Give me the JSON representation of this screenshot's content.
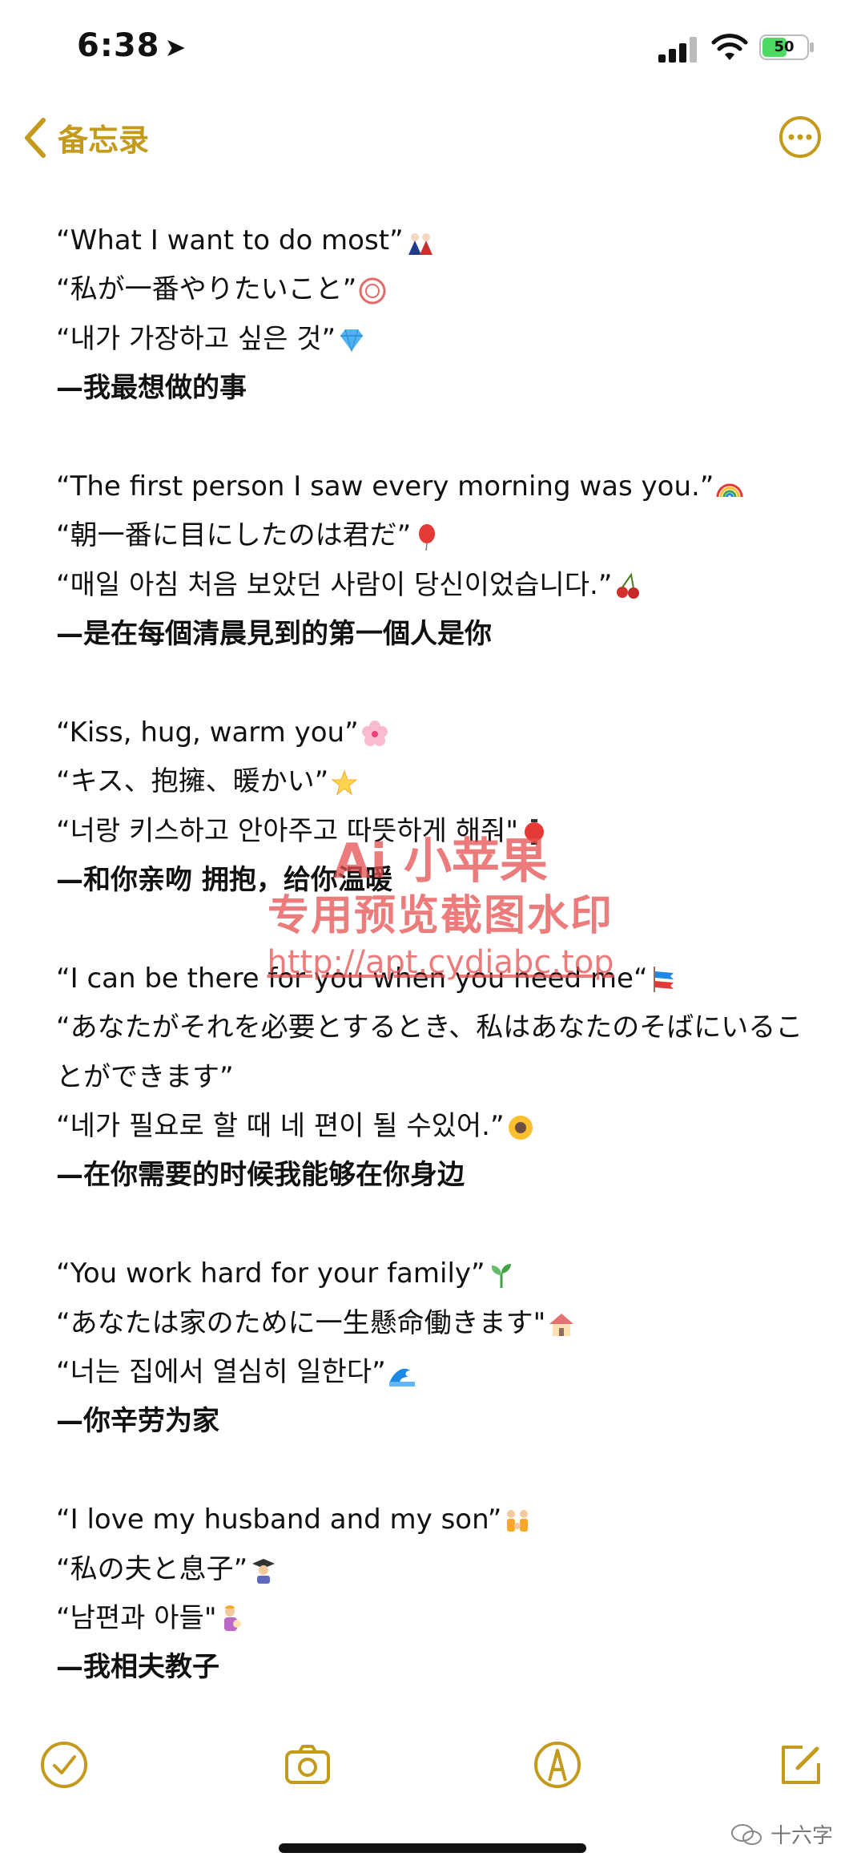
{
  "status_bar": {
    "time": "6:38",
    "battery": "50"
  },
  "nav": {
    "back_label": "备忘录"
  },
  "note": {
    "lines": [
      {
        "text": "“What I want to do most”",
        "emoji": "kimono-dolls"
      },
      {
        "text": "“私が一番やりたいこと”",
        "emoji": "maru-stamp"
      },
      {
        "text": "“내가 가장하고 싶은 것”",
        "emoji": "gem"
      },
      {
        "text": "—我最想做的事"
      },
      {
        "text": ""
      },
      {
        "text": "“The first person I saw every morning was you.”",
        "emoji": "rainbow"
      },
      {
        "text": "“朝一番に目にしたのは君だ”",
        "emoji": "balloon"
      },
      {
        "text": "“매일 아침 처음 보았던 사람이 당신이었습니다.”",
        "emoji": "cherries"
      },
      {
        "text": "—是在每個清晨見到的第一個人是你"
      },
      {
        "text": ""
      },
      {
        "text": "“Kiss, hug, warm you”",
        "emoji": "cherry-blossom"
      },
      {
        "text": "“キス、抱擁、暖かい”",
        "emoji": "glowing-star"
      },
      {
        "text": "“너랑 키스하고 안아주고 따뜻하게 해줘\"",
        "emoji": "red-lantern"
      },
      {
        "text": "—和你亲吻 拥抱，给你温暖"
      },
      {
        "text": ""
      },
      {
        "text": "“I can be there for you when you need me“",
        "emoji": "carp-streamer"
      },
      {
        "text": "“あなたがそれを必要とするとき、私はあなたのそばにいることができます”"
      },
      {
        "text": "“네가 필요로 할 때 네 편이 될 수있어.”",
        "emoji": "sunflower"
      },
      {
        "text": "—在你需要的时候我能够在你身边"
      },
      {
        "text": ""
      },
      {
        "text": "“You work hard for your family”",
        "emoji": "seedling"
      },
      {
        "text": "“あなたは家のために一生懸命働きます\"",
        "emoji": "house"
      },
      {
        "text": "“너는 집에서 열심히 일한다”",
        "emoji": "wave"
      },
      {
        "text": "—你辛劳为家"
      },
      {
        "text": ""
      },
      {
        "text": "“I love my husband and my son”",
        "emoji": "family"
      },
      {
        "text": "“私の夫と息子”",
        "emoji": "graduate"
      },
      {
        "text": "“남편과 아들\"",
        "emoji": "mother-baby"
      },
      {
        "text": "—我相夫教子"
      }
    ]
  },
  "watermark": {
    "line1": "Ai 小苹果",
    "line2": "专用预览截图水印",
    "line3": "http://apt.cydiabc.top"
  },
  "footer": {
    "wechat_label": "十六字"
  },
  "colors": {
    "accent": "#c39a1c",
    "watermark": "#e65050"
  }
}
